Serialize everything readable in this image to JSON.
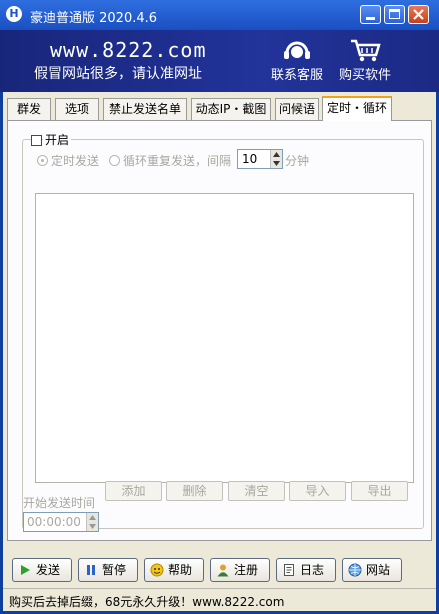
{
  "window": {
    "app_icon_letter": "H",
    "title": "豪迪普通版 2020.4.6"
  },
  "banner": {
    "site": "www.8222.com",
    "slogan": "假冒网站很多，请认准网址",
    "service_label": "联系客服",
    "buy_label": "购买软件"
  },
  "tabs": [
    {
      "label": "群发"
    },
    {
      "label": "选项"
    },
    {
      "label": "禁止发送名单"
    },
    {
      "label": "动态IP・截图"
    },
    {
      "label": "问候语"
    },
    {
      "label": "定时・循环",
      "active": true
    }
  ],
  "panel": {
    "enable_label": "开启",
    "enable_checked": false,
    "timed_send_label": "定时发送",
    "loop_label": "循环重复发送，间隔",
    "interval_value": "10",
    "interval_unit": "分钟",
    "start_time_label": "开始发送时间",
    "start_time_value": "00:00:00",
    "buttons": {
      "add": "添加",
      "delete": "删除",
      "clear": "清空",
      "import": "导入",
      "export": "导出"
    }
  },
  "bottom_buttons": {
    "send": "发送",
    "pause": "暂停",
    "help": "帮助",
    "register": "注册",
    "log": "日志",
    "website": "网站"
  },
  "status": {
    "text": "购买后去掉后缀，68元永久升级！www.8222.com"
  },
  "colors": {
    "title_bar": "#1a4fc2",
    "banner": "#22339a",
    "active_tab_accent": "#f2a21a",
    "dialog_bg": "#ece9d8",
    "disabled_text": "#a9a79e"
  }
}
